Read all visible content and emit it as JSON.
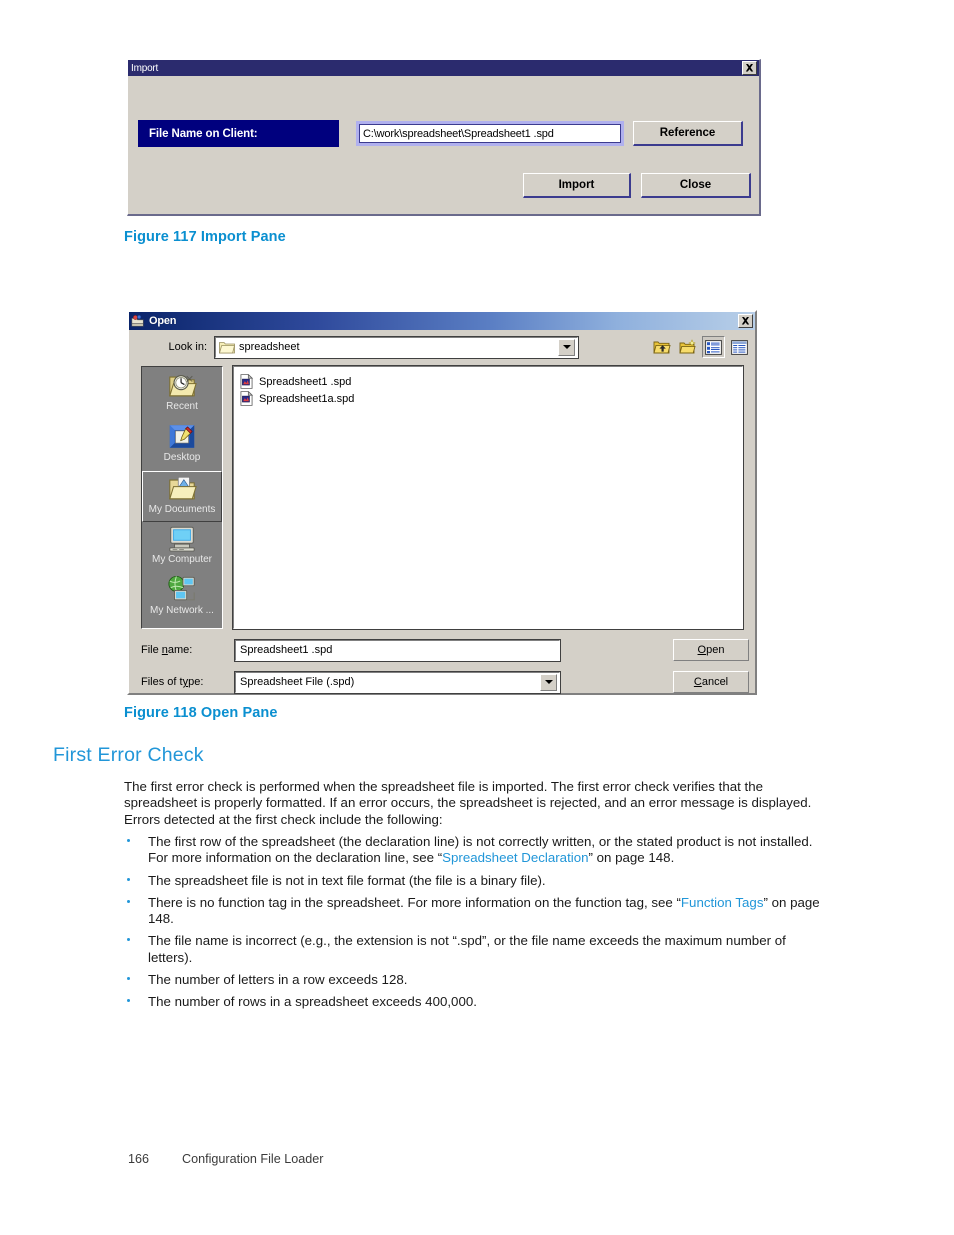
{
  "import_dialog": {
    "title": "Import",
    "close_icon": "close-x-icon",
    "field_label": "File Name on Client:",
    "field_value": "C:\\work\\spreadsheet\\Spreadsheet1 .spd",
    "reference_label": "Reference",
    "import_label": "Import",
    "close_label": "Close",
    "titlebar_color": "#2b2b6e",
    "label_color": "#00007e",
    "focus_ring_color": "#b0b0ee"
  },
  "open_dialog": {
    "title": "Open",
    "app_icon": "open-folder-app-icon",
    "close_icon": "close-x-icon",
    "lookin_label": "Look in:",
    "lookin_value": "spreadsheet",
    "lookin_icon": "folder-icon",
    "toolbar": [
      {
        "name": "up-one-level-icon",
        "label": "Up One Level",
        "pressed": false
      },
      {
        "name": "create-new-folder-icon",
        "label": "Create New Folder",
        "pressed": false
      },
      {
        "name": "list-view-icon",
        "label": "List",
        "pressed": true
      },
      {
        "name": "details-view-icon",
        "label": "Details",
        "pressed": false
      }
    ],
    "places": [
      {
        "label": "Recent",
        "icon": "recent-folder-icon",
        "selected": false
      },
      {
        "label": "Desktop",
        "icon": "desktop-icon",
        "selected": false
      },
      {
        "label": "My Documents",
        "icon": "my-documents-icon",
        "selected": true
      },
      {
        "label": "My Computer",
        "icon": "my-computer-icon",
        "selected": false
      },
      {
        "label": "My Network ...",
        "icon": "my-network-places-icon",
        "selected": false
      }
    ],
    "files": [
      {
        "name": "Spreadsheet1 .spd",
        "icon": "spd-file-icon"
      },
      {
        "name": "Spreadsheet1a.spd",
        "icon": "spd-file-icon"
      }
    ],
    "filename_label_pre": "File ",
    "filename_label_mnem": "n",
    "filename_label_post": "ame:",
    "filename_value": "Spreadsheet1 .spd",
    "filetype_label_pre": "Files of t",
    "filetype_label_mnem": "y",
    "filetype_label_post": "pe:",
    "filetype_value": "Spreadsheet File (.spd)",
    "open_btn_mnem": "O",
    "open_btn_rest": "pen",
    "cancel_btn_mnem": "C",
    "cancel_btn_rest": "ancel"
  },
  "document": {
    "figure_117_caption": "Figure 117 Import Pane",
    "figure_118_caption": "Figure 118 Open Pane",
    "heading": "First Error Check",
    "intro_paragraph": "The first error check is performed when the spreadsheet file is imported.  The first error check verifies that the spreadsheet is properly formatted.  If an error occurs, the spreadsheet is rejected, and an error message is displayed.  Errors detected at the first check include the following:",
    "bullets": [
      {
        "pre": "The first row of the spreadsheet (the declaration line) is not correctly written, or the stated product is not installed.  For more information on the declaration line, see “",
        "link": "Spreadsheet Declaration",
        "post": "” on page 148."
      },
      {
        "pre": "The spreadsheet file is not in text file format (the file is a binary file).",
        "link": "",
        "post": ""
      },
      {
        "pre": "There is no function tag in the spreadsheet.  For more information on the function tag, see “",
        "link": "Function Tags",
        "post": "” on page 148."
      },
      {
        "pre": "The file name is incorrect (e.g., the extension is not “.spd”, or the file name exceeds the maximum number of letters).",
        "link": "",
        "post": ""
      },
      {
        "pre": "The number of letters in a row exceeds 128.",
        "link": "",
        "post": ""
      },
      {
        "pre": "The number of rows in a spreadsheet exceeds 400,000.",
        "link": "",
        "post": ""
      }
    ],
    "footer_page_number": "166",
    "footer_title": "Configuration File Loader",
    "accent_color": "#2196d8",
    "caption_color": "#0a8fd0"
  }
}
